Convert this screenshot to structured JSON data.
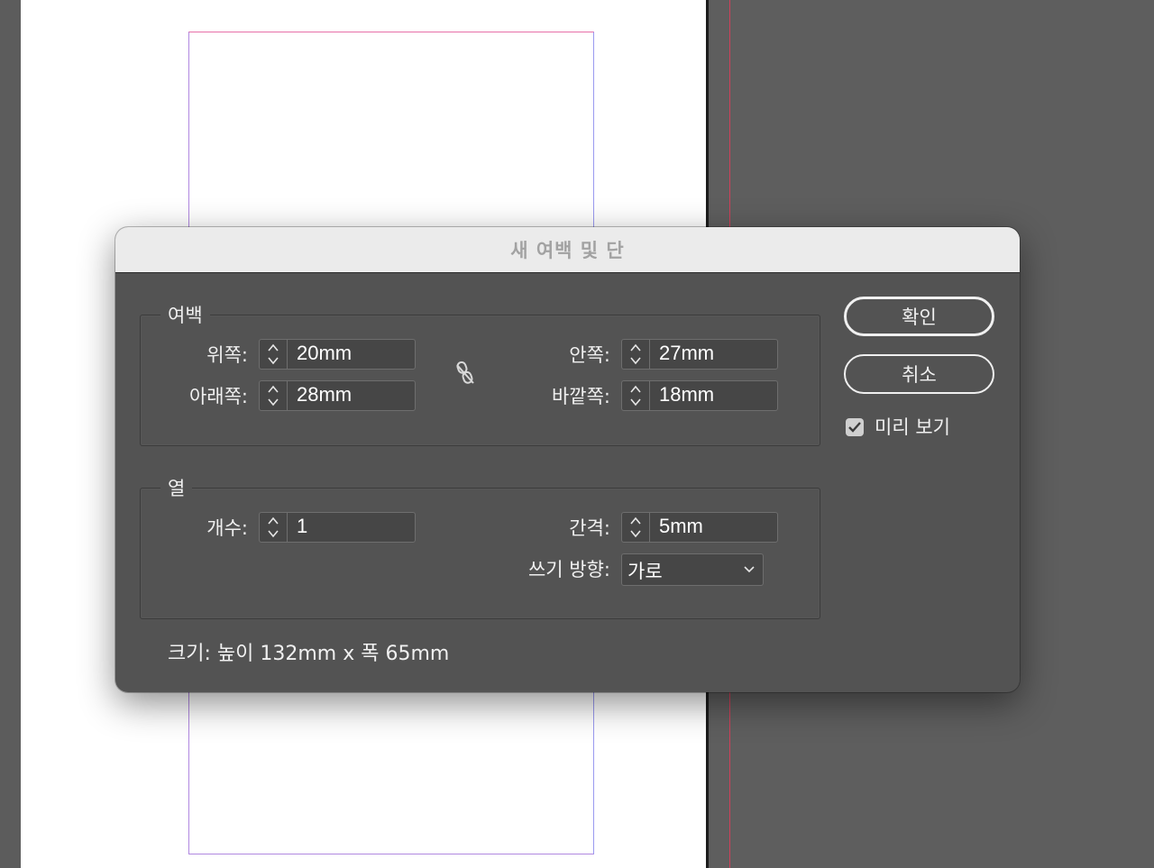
{
  "dialog": {
    "title": "새 여백 및 단",
    "margins": {
      "group_label": "여백",
      "top": {
        "label": "위쪽:",
        "value": "20mm"
      },
      "bottom": {
        "label": "아래쪽:",
        "value": "28mm"
      },
      "inside": {
        "label": "안쪽:",
        "value": "27mm"
      },
      "outside": {
        "label": "바깥쪽:",
        "value": "18mm"
      },
      "link_icon": "broken-chain-icon",
      "linked": false
    },
    "columns": {
      "group_label": "열",
      "count": {
        "label": "개수:",
        "value": "1"
      },
      "gutter": {
        "label": "간격:",
        "value": "5mm"
      },
      "writing_direction": {
        "label": "쓰기 방향:",
        "value": "가로"
      }
    },
    "size_info": "크기: 높이 132mm x 폭 65mm",
    "buttons": {
      "ok": "확인",
      "cancel": "취소"
    },
    "preview": {
      "label": "미리 보기",
      "checked": true
    }
  },
  "colors": {
    "dialog_bg": "#535353",
    "titlebar_bg": "#ebebeb",
    "field_bg": "#464646",
    "text": "#f0f0f0",
    "margin_guide": "#b088e0",
    "bleed_guide": "#d0405a"
  }
}
